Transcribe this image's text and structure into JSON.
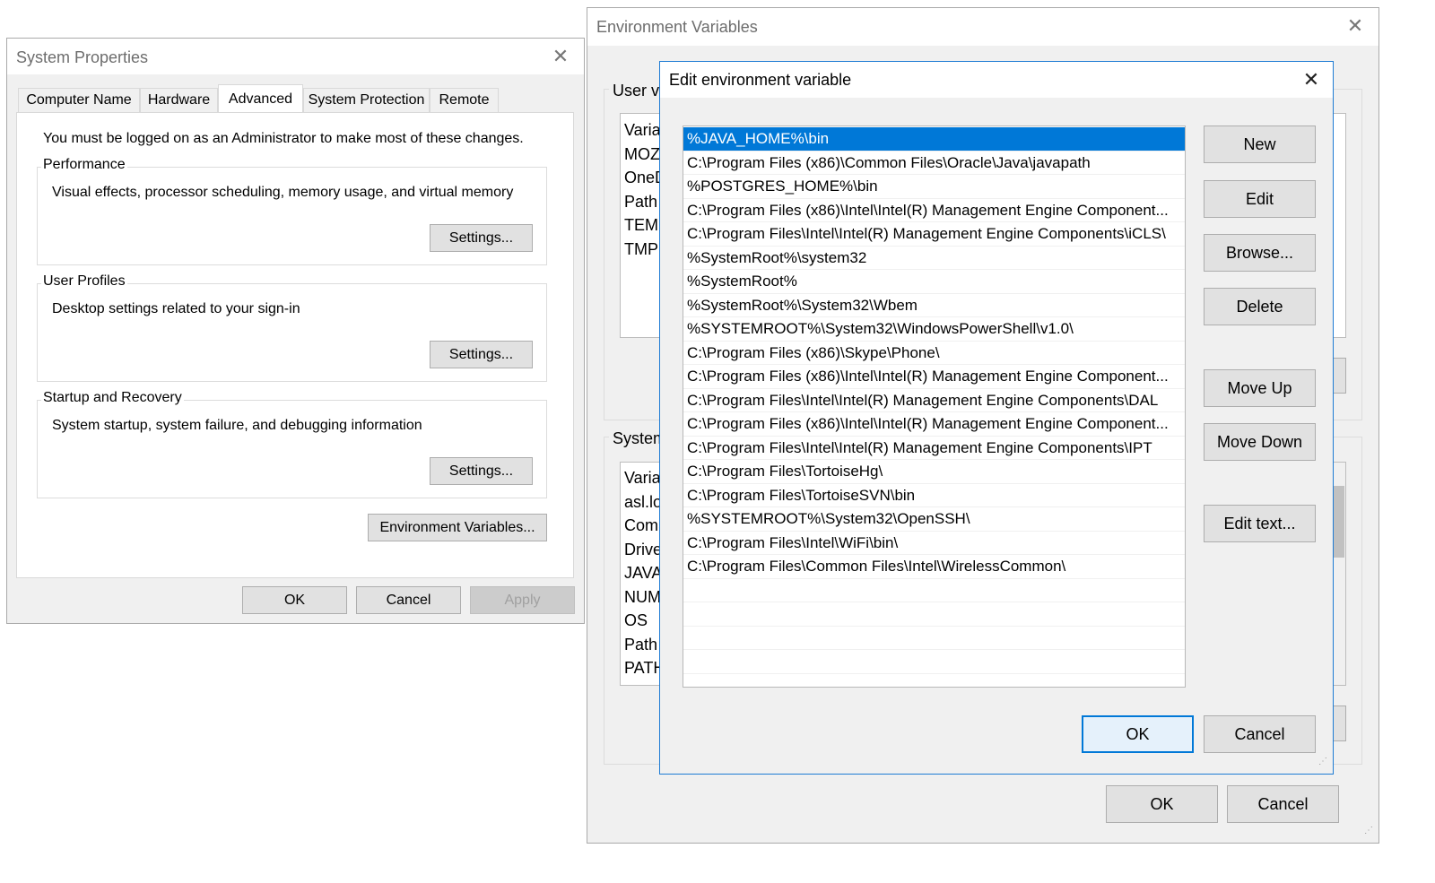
{
  "sysprops": {
    "title": "System Properties",
    "close": "✕",
    "tabs": [
      "Computer Name",
      "Hardware",
      "Advanced",
      "System Protection",
      "Remote"
    ],
    "admin_note": "You must be logged on as an Administrator to make most of these changes.",
    "performance": {
      "title": "Performance",
      "desc": "Visual effects, processor scheduling, memory usage, and virtual memory",
      "button": "Settings..."
    },
    "user_profiles": {
      "title": "User Profiles",
      "desc": "Desktop settings related to your sign-in",
      "button": "Settings..."
    },
    "startup": {
      "title": "Startup and Recovery",
      "desc": "System startup, system failure, and debugging information",
      "button": "Settings..."
    },
    "env_button": "Environment Variables...",
    "ok": "OK",
    "cancel": "Cancel",
    "apply": "Apply"
  },
  "envvars": {
    "title": "Environment Variables",
    "close": "✕",
    "user_label": "User va",
    "user_rows": [
      "Varia",
      "MOZ",
      "OneD",
      "Path",
      "TEMF",
      "TMP"
    ],
    "system_label": "System",
    "system_rows": [
      "Varia",
      "asl.lo",
      "ComS",
      "Drive",
      "JAVA_",
      "NUM",
      "OS",
      "Path",
      "PATH"
    ],
    "ok": "OK",
    "cancel": "Cancel"
  },
  "editdlg": {
    "title": "Edit environment variable",
    "close": "✕",
    "paths": [
      "%JAVA_HOME%\\bin",
      "C:\\Program Files (x86)\\Common Files\\Oracle\\Java\\javapath",
      "%POSTGRES_HOME%\\bin",
      "C:\\Program Files (x86)\\Intel\\Intel(R) Management Engine Component...",
      "C:\\Program Files\\Intel\\Intel(R) Management Engine Components\\iCLS\\",
      "%SystemRoot%\\system32",
      "%SystemRoot%",
      "%SystemRoot%\\System32\\Wbem",
      "%SYSTEMROOT%\\System32\\WindowsPowerShell\\v1.0\\",
      "C:\\Program Files (x86)\\Skype\\Phone\\",
      "C:\\Program Files (x86)\\Intel\\Intel(R) Management Engine Component...",
      "C:\\Program Files\\Intel\\Intel(R) Management Engine Components\\DAL",
      "C:\\Program Files (x86)\\Intel\\Intel(R) Management Engine Component...",
      "C:\\Program Files\\Intel\\Intel(R) Management Engine Components\\IPT",
      "C:\\Program Files\\TortoiseHg\\",
      "C:\\Program Files\\TortoiseSVN\\bin",
      "%SYSTEMROOT%\\System32\\OpenSSH\\",
      "C:\\Program Files\\Intel\\WiFi\\bin\\",
      "C:\\Program Files\\Common Files\\Intel\\WirelessCommon\\",
      "",
      "",
      "",
      "",
      ""
    ],
    "buttons": {
      "new": "New",
      "edit": "Edit",
      "browse": "Browse...",
      "delete": "Delete",
      "move_up": "Move Up",
      "move_down": "Move Down",
      "edit_text": "Edit text..."
    },
    "ok": "OK",
    "cancel": "Cancel"
  }
}
